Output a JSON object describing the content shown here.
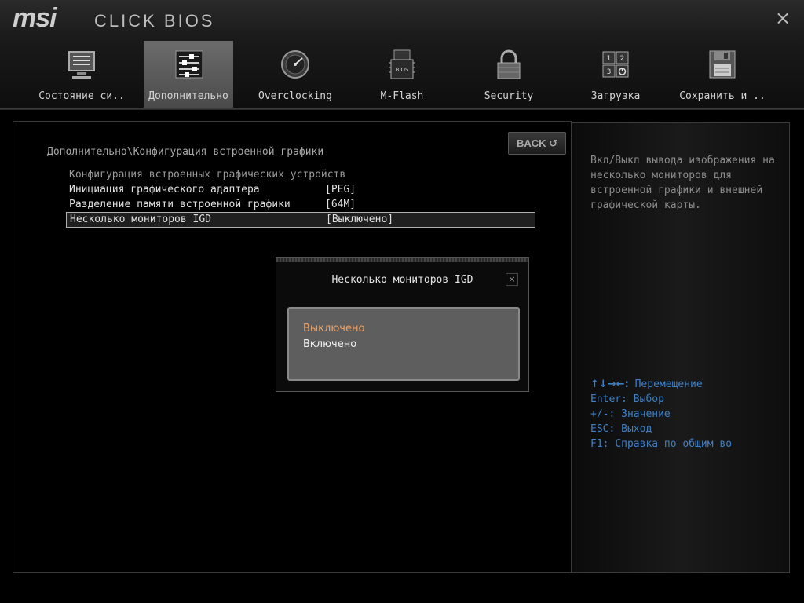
{
  "header": {
    "brand": "msi",
    "product": "CLICK BIOS",
    "close_symbol": "×"
  },
  "tabs": [
    {
      "label": "Состояние си..",
      "icon": "monitor-icon",
      "active": false
    },
    {
      "label": "Дополнительно",
      "icon": "settings-sliders-icon",
      "active": true
    },
    {
      "label": "Overclocking",
      "icon": "gauge-icon",
      "active": false
    },
    {
      "label": "M-Flash",
      "icon": "bios-chip-icon",
      "active": false
    },
    {
      "label": "Security",
      "icon": "lock-icon",
      "active": false
    },
    {
      "label": "Загрузка",
      "icon": "boot-order-icon",
      "active": false
    },
    {
      "label": "Сохранить и ..",
      "icon": "floppy-disk-icon",
      "active": false
    }
  ],
  "back_button": {
    "label": "BACK",
    "icon": "↺"
  },
  "breadcrumb": "Дополнительно\\Конфигурация встроенной графики",
  "settings": {
    "section_title": "Конфигурация встроенных графических устройств",
    "items": [
      {
        "name": "Инициация графического адаптера",
        "value": "[PEG]"
      },
      {
        "name": "Разделение памяти встроенной графики",
        "value": "[64M]"
      },
      {
        "name": "Несколько мониторов IGD",
        "value": "[Выключено]",
        "selected": true
      }
    ]
  },
  "dialog": {
    "title": "Несколько мониторов IGD",
    "close_symbol": "×",
    "options": [
      {
        "label": "Выключено",
        "highlighted": true
      },
      {
        "label": "Включено",
        "highlighted": false
      }
    ]
  },
  "help": {
    "description": "Вкл/Выкл вывода изображения на несколько мониторов для встроенной графики и внешней графической карты.",
    "keys": [
      {
        "key": "↑↓→←:",
        "action": "Перемещение"
      },
      {
        "key": "Enter:",
        "action": "Выбор"
      },
      {
        "key": "+/-:",
        "action": "Значение"
      },
      {
        "key": "ESC:",
        "action": "Выход"
      },
      {
        "key": "F1:",
        "action": "Справка по общим во"
      }
    ]
  },
  "colors": {
    "accent_text": "#e0e0e0",
    "highlight_option": "#f0a060",
    "key_hint": "#3e7fc3",
    "active_tab": "#5a5a5a"
  }
}
